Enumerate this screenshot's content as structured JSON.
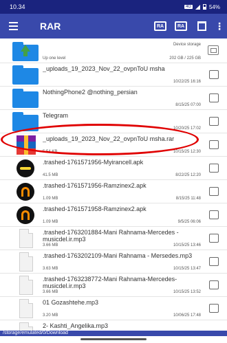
{
  "status": {
    "time": "10.34",
    "network": "4G",
    "battery": "54%"
  },
  "toolbar": {
    "title": "RAR",
    "archive_btn": "RA",
    "extract_btn": "RA",
    "delete_icon": "trash-icon",
    "more_icon": "more-vert-icon"
  },
  "rows": [
    {
      "icon": "folder-up-icon",
      "name": "",
      "meta_left": "Up one level",
      "meta_right_top": "Device storage",
      "meta_right": "202 GB / 225 GB"
    },
    {
      "icon": "folder-icon",
      "name": "_uploads_19_2023_Nov_22_ovpnToU msha",
      "meta_left": "",
      "meta_right": "10/22/25 16:16"
    },
    {
      "icon": "folder-icon",
      "name": "NothingPhone2 @nothing_persian",
      "meta_left": "",
      "meta_right": "8/15/25 07:00"
    },
    {
      "icon": "folder-icon",
      "name": "Telegram",
      "meta_left": "",
      "meta_right": "10/20/25 17:02"
    },
    {
      "icon": "rar-file-icon",
      "name": "_uploads_19_2023_Nov_22_ovpnToU msha.rar",
      "meta_left": "5.54 KB",
      "meta_right": "10/15/25 12:30"
    },
    {
      "icon": "apk-icon",
      "name": ".trashed-1761571956-Myirancell.apk",
      "meta_left": "41.5 MB",
      "meta_right": "8/22/25 12:20"
    },
    {
      "icon": "apk-icon",
      "name": ".trashed-1761571956-Ramzinex2.apk",
      "meta_left": "1.09 MB",
      "meta_right": "8/15/25 11:48"
    },
    {
      "icon": "apk-icon",
      "name": ".trashed-1761571958-Ramzinex2.apk",
      "meta_left": "1.09 MB",
      "meta_right": "9/5/25 06:06"
    },
    {
      "icon": "audio-file-icon",
      "name": ".trashed-1763201884-Mani Rahnama-Mercedes -musicdel.ir.mp3",
      "meta_left": "3.66 MB",
      "meta_right": "10/15/25 13:46"
    },
    {
      "icon": "audio-file-icon",
      "name": ".trashed-1763202109-Mani Rahnama - Mersedes.mp3",
      "meta_left": "3.63 MB",
      "meta_right": "10/15/25 13:47"
    },
    {
      "icon": "audio-file-icon",
      "name": ".trashed-1763238772-Mani Rahnama-Mercedes-musicdel.ir.mp3",
      "meta_left": "3.66 MB",
      "meta_right": "10/15/25 13:52"
    },
    {
      "icon": "audio-file-icon",
      "name": "01 Gozashtehe.mp3",
      "meta_left": "3.20 MB",
      "meta_right": "10/06/25 17:48"
    },
    {
      "icon": "audio-file-icon",
      "name": "2- Kashti_Angelika.mp3",
      "meta_left": "",
      "meta_right": ""
    }
  ],
  "path": "/storage/emulated/0/Download"
}
